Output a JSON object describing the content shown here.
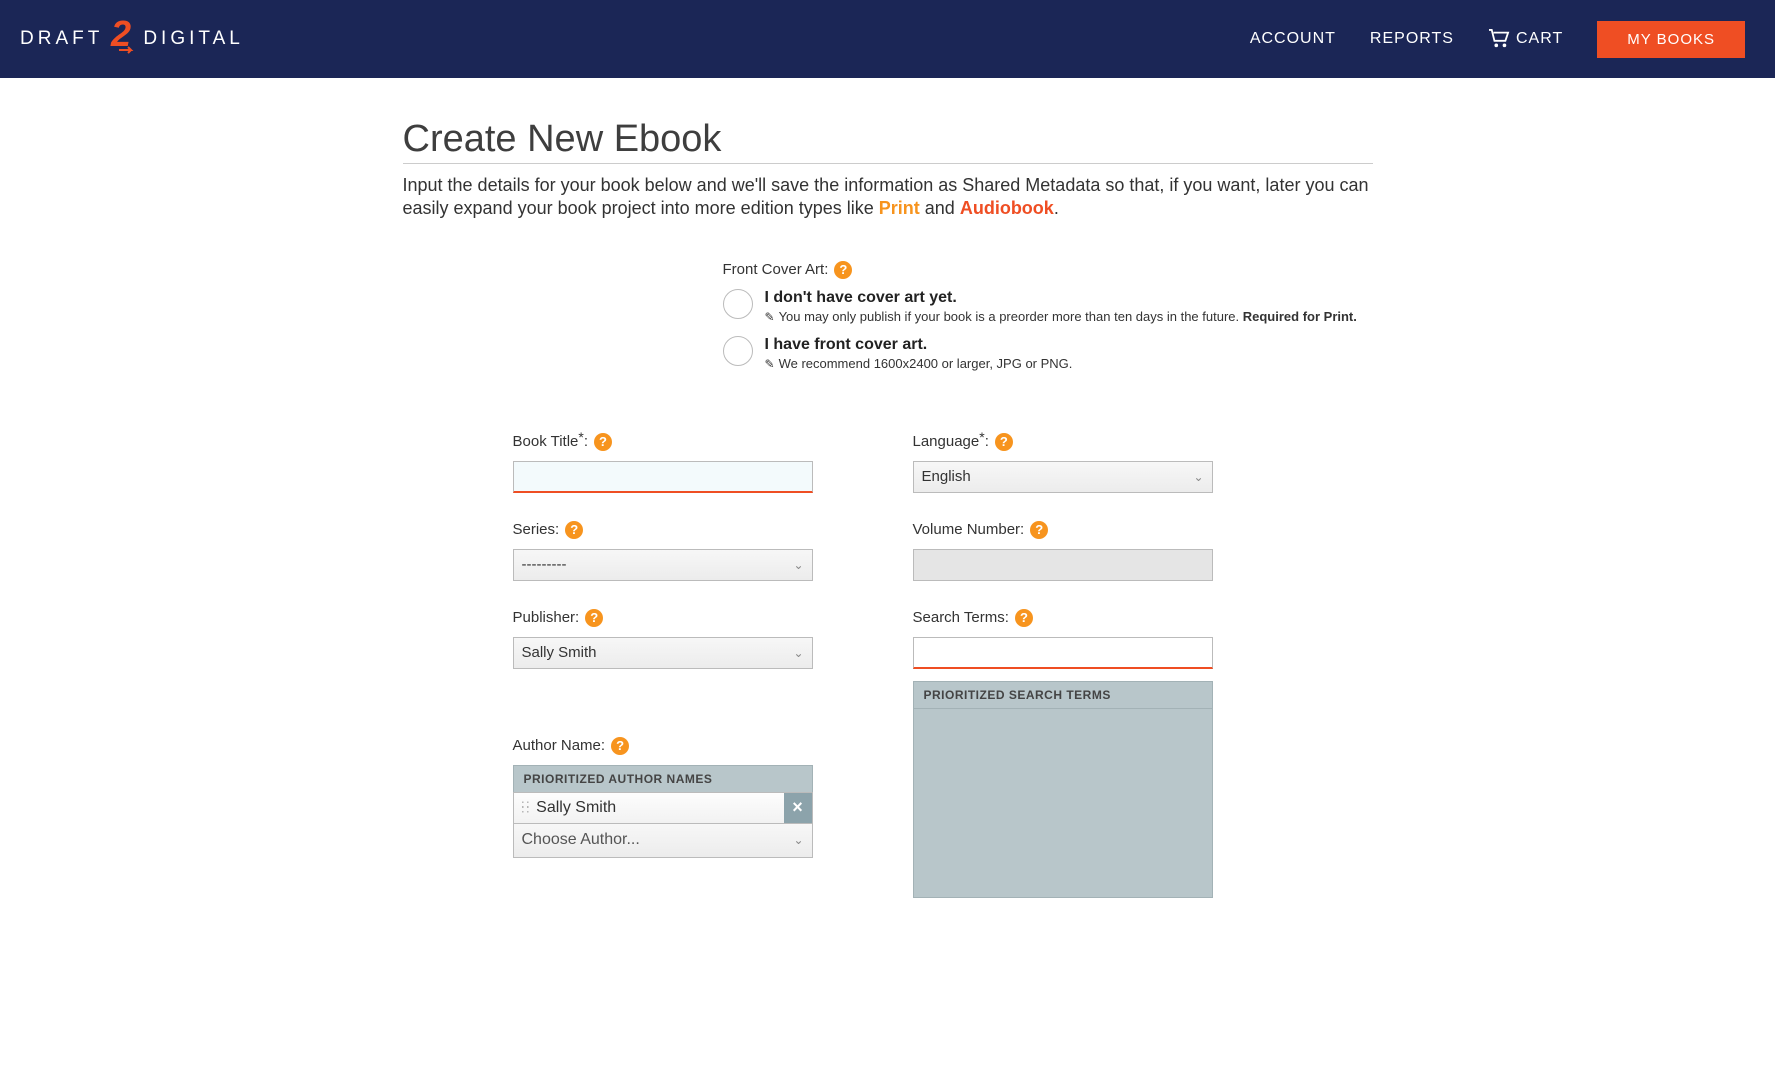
{
  "header": {
    "brand_left": "DRAFT",
    "brand_right": "DIGITAL",
    "nav": {
      "account": "ACCOUNT",
      "reports": "REPORTS",
      "cart": "CART",
      "my_books": "MY BOOKS"
    }
  },
  "page": {
    "title": "Create New Ebook",
    "intro_a": "Input the details for your book below and we'll save the information as Shared Metadata so that, if you want, later you can easily expand your book project into more edition types like ",
    "intro_print": "Print",
    "intro_and": " and ",
    "intro_audio": "Audiobook",
    "intro_end": "."
  },
  "cover": {
    "label": "Front Cover Art:",
    "opt1_label": "I don't have cover art yet.",
    "opt1_note_a": "You may only publish if your book is a preorder more than ten days in the future. ",
    "opt1_note_b": "Required for Print.",
    "opt2_label": "I have front cover art.",
    "opt2_note": "We recommend 1600x2400 or larger, JPG or PNG."
  },
  "fields": {
    "book_title_label": "Book Title",
    "language_label": "Language",
    "language_value": "English",
    "series_label": "Series:",
    "series_value": "---------",
    "volume_label": "Volume Number:",
    "publisher_label": "Publisher:",
    "publisher_value": "Sally Smith",
    "search_terms_label": "Search Terms:",
    "author_label": "Author Name:",
    "author_panel_header": "PRIORITIZED AUTHOR NAMES",
    "author_chip": "Sally Smith",
    "choose_author": "Choose Author...",
    "search_panel_header": "PRIORITIZED SEARCH TERMS"
  },
  "glyphs": {
    "help": "?",
    "colon": ":",
    "star": "*",
    "x": "×",
    "chevron": "⌄"
  }
}
